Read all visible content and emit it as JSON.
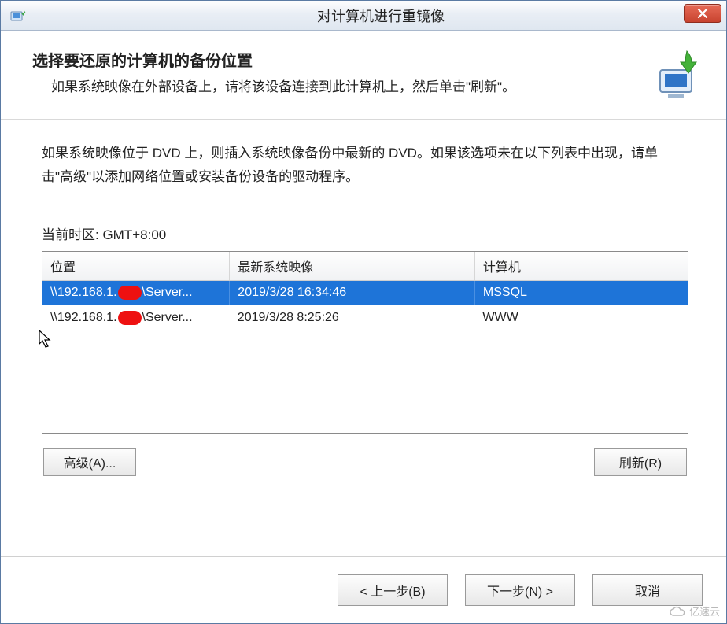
{
  "window": {
    "title": "对计算机进行重镜像"
  },
  "header": {
    "heading": "选择要还原的计算机的备份位置",
    "subtext": "如果系统映像在外部设备上，请将该设备连接到此计算机上，然后单击\"刷新\"。"
  },
  "instruction": "如果系统映像位于 DVD 上，则插入系统映像备份中最新的 DVD。如果该选项未在以下列表中出现，请单击\"高级\"以添加网络位置或安装备份设备的驱动程序。",
  "timezone": {
    "label_prefix": "当前时区: ",
    "value": "GMT+8:00"
  },
  "table": {
    "columns": {
      "location": "位置",
      "latest": "最新系统映像",
      "computer": "计算机"
    },
    "rows": [
      {
        "location_prefix": "\\\\192.168.1.",
        "location_suffix": "\\Server...",
        "latest": "2019/3/28 16:34:46",
        "computer": "MSSQL",
        "selected": true
      },
      {
        "location_prefix": "\\\\192.168.1.",
        "location_suffix": "\\Server...",
        "latest": "2019/3/28 8:25:26",
        "computer": "WWW",
        "selected": false
      }
    ]
  },
  "buttons": {
    "advanced": "高级(A)...",
    "refresh": "刷新(R)",
    "back": "< 上一步(B)",
    "next": "下一步(N) >",
    "cancel": "取消"
  },
  "watermark": "亿速云"
}
